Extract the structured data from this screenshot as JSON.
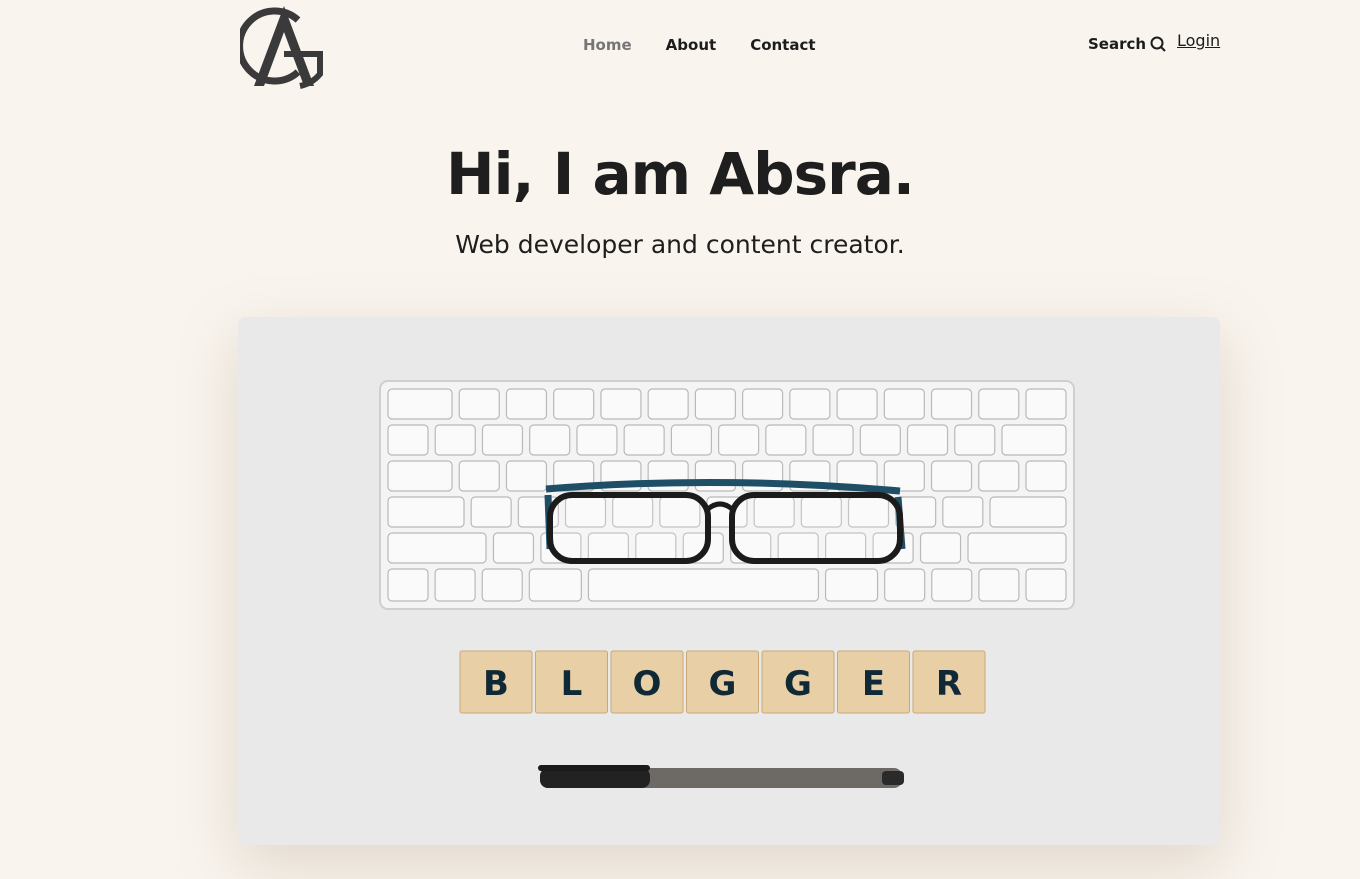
{
  "nav": {
    "items": [
      {
        "label": "Home",
        "active": true
      },
      {
        "label": "About",
        "active": false
      },
      {
        "label": "Contact",
        "active": false
      }
    ],
    "search_label": "Search",
    "login_label": "Login"
  },
  "hero": {
    "title": "Hi, I am Absra.",
    "subtitle": "Web developer and content creator."
  },
  "image": {
    "tiles": [
      "B",
      "L",
      "O",
      "G",
      "G",
      "E",
      "R"
    ]
  },
  "colors": {
    "background": "#f9f4ee",
    "text": "#1c1c1c",
    "nav_active": "#767676"
  }
}
